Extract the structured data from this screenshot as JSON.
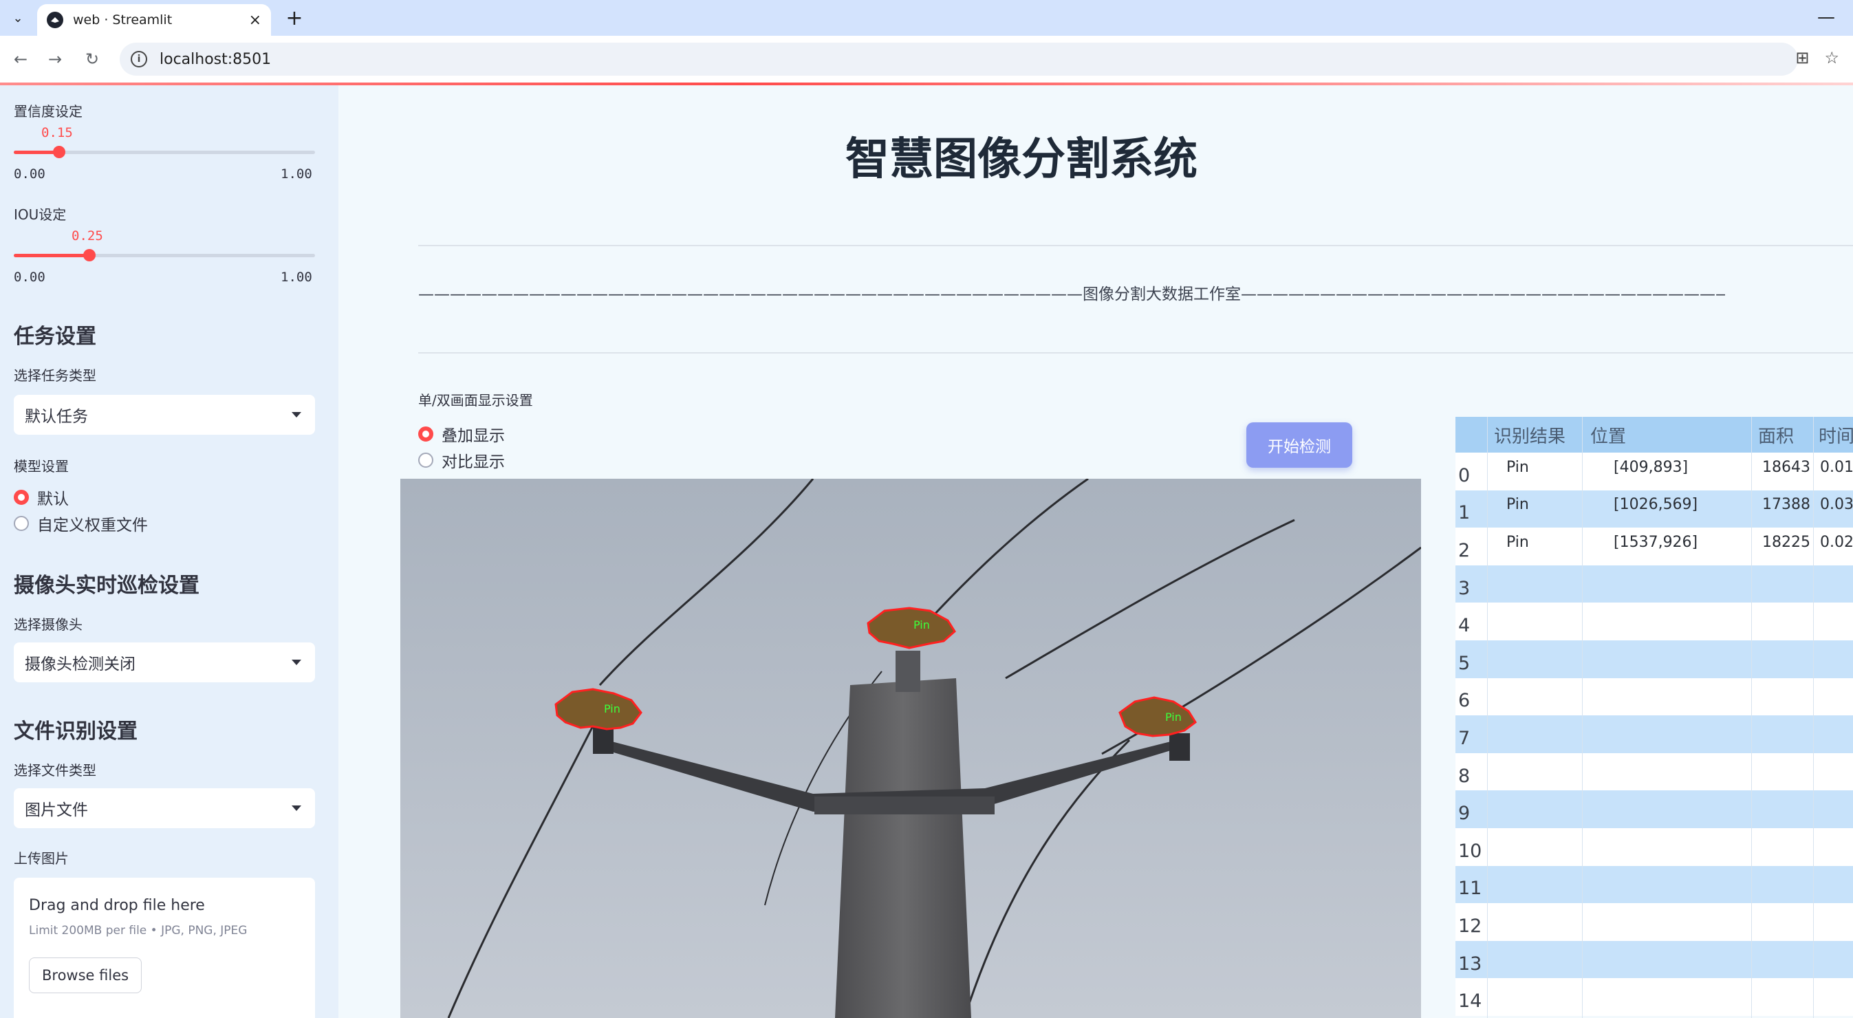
{
  "browser": {
    "tab_title": "web · Streamlit",
    "url": "localhost:8501"
  },
  "sidebar": {
    "confidence": {
      "label": "置信度设定",
      "value": "0.15",
      "value_num": 0.15,
      "min": "0.00",
      "max": "1.00"
    },
    "iou": {
      "label": "IOU设定",
      "value": "0.25",
      "value_num": 0.25,
      "min": "0.00",
      "max": "1.00"
    },
    "task_heading": "任务设置",
    "task_type_label": "选择任务类型",
    "task_type_value": "默认任务",
    "model_label": "模型设置",
    "model_options": [
      "默认",
      "自定义权重文件"
    ],
    "model_selected": "默认",
    "camera_heading": "摄像头实时巡检设置",
    "camera_label": "选择摄像头",
    "camera_value": "摄像头检测关闭",
    "file_heading": "文件识别设置",
    "file_type_label": "选择文件类型",
    "file_type_value": "图片文件",
    "upload_label": "上传图片",
    "upload_title": "Drag and drop file here",
    "upload_sub": "Limit 200MB per file • JPG, PNG, JPEG",
    "browse_label": "Browse files"
  },
  "main": {
    "title": "智慧图像分割系统",
    "banner": "——————————————————————————————————————————图像分割大数据工作室——————————————————————————————————————————",
    "display_label": "单/双画面显示设置",
    "display_options": [
      "叠加显示",
      "对比显示"
    ],
    "display_selected": "叠加显示",
    "start_button": "开始检测",
    "detection_label": "Pin"
  },
  "table": {
    "columns": [
      "识别结果",
      "位置",
      "面积",
      "时间"
    ],
    "rows": [
      {
        "index": "0",
        "result": "Pin",
        "position": "[409,893]",
        "area": "18643",
        "time": "0.01"
      },
      {
        "index": "1",
        "result": "Pin",
        "position": "[1026,569]",
        "area": "17388",
        "time": "0.03"
      },
      {
        "index": "2",
        "result": "Pin",
        "position": "[1537,926]",
        "area": "18225",
        "time": "0.02"
      },
      {
        "index": "3"
      },
      {
        "index": "4"
      },
      {
        "index": "5"
      },
      {
        "index": "6"
      },
      {
        "index": "7"
      },
      {
        "index": "8"
      },
      {
        "index": "9"
      },
      {
        "index": "10"
      },
      {
        "index": "11"
      },
      {
        "index": "12"
      },
      {
        "index": "13"
      },
      {
        "index": "14"
      }
    ]
  },
  "colors": {
    "accent": "#ff4b4b",
    "button": "#8c9cf2",
    "table_header": "#a6d0f4",
    "table_alt_row": "#c7e2fa"
  }
}
